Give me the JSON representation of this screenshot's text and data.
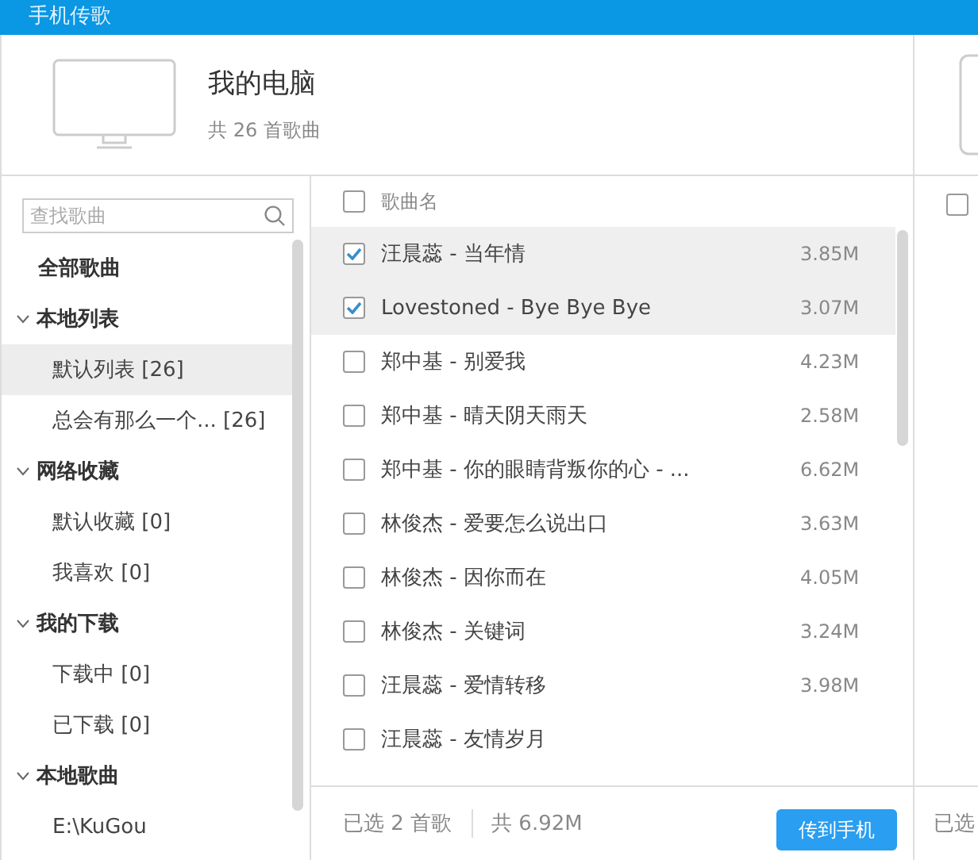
{
  "window": {
    "title": "手机传歌"
  },
  "computer": {
    "name": "我的电脑",
    "count": "共 26 首歌曲"
  },
  "sidebar": {
    "search": {
      "placeholder": "查找歌曲"
    },
    "items": [
      {
        "label": "全部歌曲",
        "selected": false
      },
      {
        "label": "本地列表",
        "expanded": true,
        "children": [
          {
            "label": "默认列表 [26]",
            "selected": true
          },
          {
            "label": "总会有那么一个... [26]",
            "selected": false
          }
        ]
      },
      {
        "label": "网络收藏",
        "expanded": true,
        "children": [
          {
            "label": "默认收藏 [0]",
            "selected": false
          },
          {
            "label": "我喜欢 [0]",
            "selected": false
          }
        ]
      },
      {
        "label": "我的下载",
        "expanded": true,
        "children": [
          {
            "label": "下载中 [0]",
            "selected": false
          },
          {
            "label": "已下载 [0]",
            "selected": false
          }
        ]
      },
      {
        "label": "本地歌曲",
        "expanded": true,
        "children": [
          {
            "label": "E:\\KuGou",
            "selected": false
          }
        ]
      }
    ]
  },
  "songs": {
    "header": {
      "label": "歌曲名",
      "checked": false
    },
    "rows": [
      {
        "name": "汪晨蕊 - 当年情",
        "size": "3.85M",
        "checked": true
      },
      {
        "name": "Lovestoned - Bye Bye Bye",
        "size": "3.07M",
        "checked": true
      },
      {
        "name": "郑中基 - 别爱我",
        "size": "4.23M",
        "checked": false
      },
      {
        "name": "郑中基 - 晴天阴天雨天",
        "size": "2.58M",
        "checked": false
      },
      {
        "name": "郑中基 - 你的眼睛背叛你的心 - ...",
        "size": "6.62M",
        "checked": false
      },
      {
        "name": "林俊杰 - 爱要怎么说出口",
        "size": "3.63M",
        "checked": false
      },
      {
        "name": "林俊杰 - 因你而在",
        "size": "4.05M",
        "checked": false
      },
      {
        "name": "林俊杰 - 关键词",
        "size": "3.24M",
        "checked": false
      },
      {
        "name": "汪晨蕊 - 爱情转移",
        "size": "3.98M",
        "checked": false
      },
      {
        "name": "汪晨蕊 - 友情岁月",
        "size": "",
        "checked": false
      }
    ]
  },
  "footer": {
    "selected": "已选 2 首歌",
    "total": "共 6.92M",
    "button": "传到手机"
  },
  "phone_panel": {
    "header_checked": false,
    "footer": "已选"
  }
}
